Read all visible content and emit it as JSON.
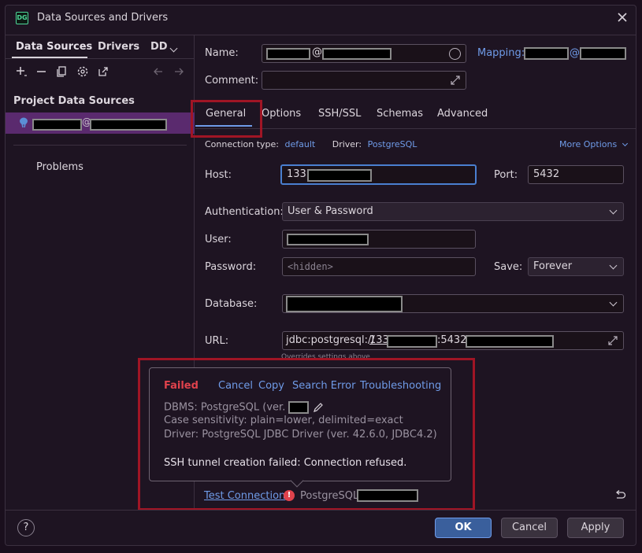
{
  "window": {
    "title": "Data Sources and Drivers",
    "logo": "DG"
  },
  "left": {
    "tabs": [
      "Data Sources",
      "Drivers",
      "DD"
    ],
    "section_title": "Project Data Sources",
    "problems": "Problems"
  },
  "form": {
    "name_label": "Name:",
    "name_at": "@",
    "mapping_label": "Mapping:",
    "mapping_at": "@",
    "comment_label": "Comment:",
    "tabs": [
      "General",
      "Options",
      "SSH/SSL",
      "Schemas",
      "Advanced"
    ],
    "conn_type_label": "Connection type:",
    "conn_type_value": "default",
    "driver_label": "Driver:",
    "driver_value": "PostgreSQL",
    "more_options": "More Options",
    "host_label": "Host:",
    "host_value": "133.",
    "port_label": "Port:",
    "port_value": "5432",
    "auth_label": "Authentication:",
    "auth_value": "User & Password",
    "user_label": "User:",
    "password_label": "Password:",
    "password_placeholder": "<hidden>",
    "save_label": "Save:",
    "save_value": "Forever",
    "database_label": "Database:",
    "url_label": "URL:",
    "url_prefix": "jdbc:postgresql://",
    "url_host": "133",
    "url_port": ":5432/",
    "overrides_note": "Overrides settings above"
  },
  "popup": {
    "status": "Failed",
    "actions": [
      "Cancel",
      "Copy",
      "Search Error",
      "Troubleshooting"
    ],
    "dbms": "DBMS: PostgreSQL (ver.",
    "case": "Case sensitivity: plain=lower, delimited=exact",
    "driver": "Driver: PostgreSQL JDBC Driver (ver. 42.6.0, JDBC4.2)",
    "message": "SSH tunnel creation failed: Connection refused."
  },
  "bottom": {
    "test_connection": "Test Connection",
    "driver_name": "PostgreSQL",
    "help": "?",
    "ok": "OK",
    "cancel": "Cancel",
    "apply": "Apply"
  },
  "colors": {
    "accent": "#6f9be8",
    "error": "#e0424c",
    "highlight_frame": "#a01525",
    "selection": "#5a2a6e"
  },
  "icons": [
    "add-icon",
    "remove-icon",
    "copy-icon",
    "settings-icon",
    "export-icon",
    "back-arrow-icon",
    "forward-arrow-icon",
    "close-icon",
    "expand-icon",
    "edit-icon",
    "error-icon",
    "revert-icon",
    "postgres-icon",
    "chevron-down-icon"
  ]
}
